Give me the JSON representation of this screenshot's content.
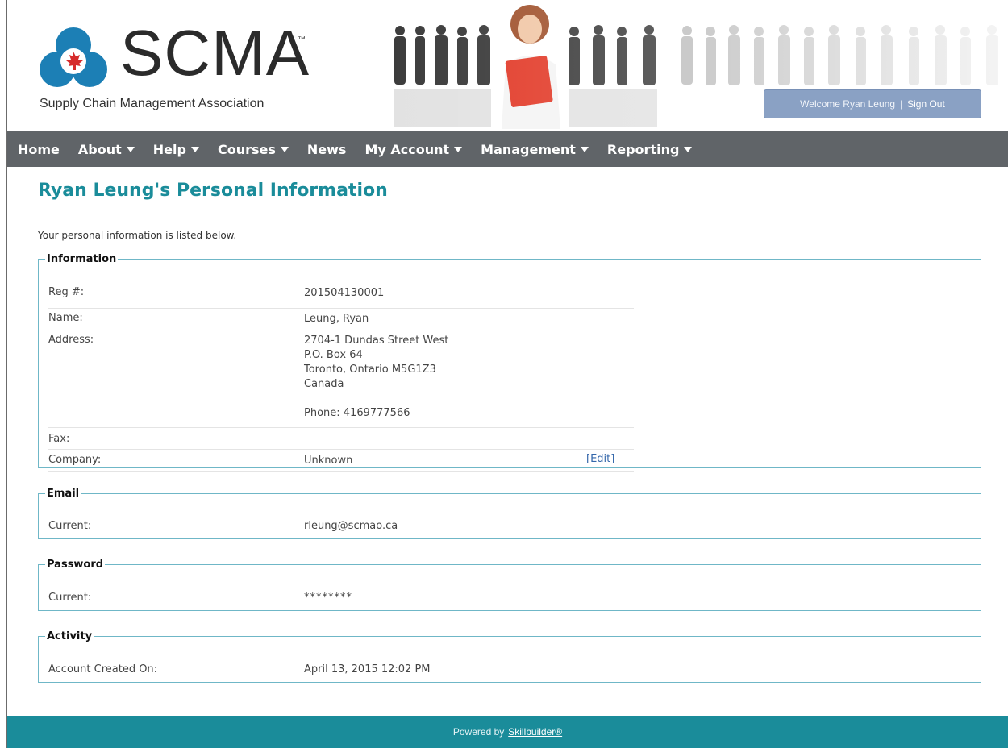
{
  "header": {
    "logo_text": "SCMA",
    "logo_tm": "™",
    "logo_subtitle": "Supply Chain Management Association",
    "welcome_text": "Welcome Ryan Leung",
    "separator": "|",
    "signout_label": "Sign Out"
  },
  "nav": {
    "items": [
      {
        "label": "Home",
        "caret": false
      },
      {
        "label": "About",
        "caret": true
      },
      {
        "label": "Help",
        "caret": true
      },
      {
        "label": "Courses",
        "caret": true
      },
      {
        "label": "News",
        "caret": false
      },
      {
        "label": "My Account",
        "caret": true
      },
      {
        "label": "Management",
        "caret": true
      },
      {
        "label": "Reporting",
        "caret": true
      }
    ]
  },
  "page": {
    "title": "Ryan Leung's Personal Information",
    "intro": "Your personal information is listed below."
  },
  "information": {
    "legend": "Information",
    "reg_label": "Reg #:",
    "reg_value": "201504130001",
    "name_label": "Name:",
    "name_value": "Leung, Ryan",
    "address_label": "Address:",
    "address_lines": [
      "2704-1 Dundas Street West",
      "P.O. Box 64",
      "Toronto, Ontario M5G1Z3",
      "Canada"
    ],
    "phone": "Phone: 4169777566",
    "fax_label": "Fax:",
    "fax_value": "",
    "company_label": "Company:",
    "company_value": "Unknown",
    "edit_label": "[Edit]"
  },
  "email": {
    "legend": "Email",
    "current_label": "Current:",
    "current_value": "rleung@scmao.ca"
  },
  "password": {
    "legend": "Password",
    "current_label": "Current:",
    "current_value": "********"
  },
  "activity": {
    "legend": "Activity",
    "created_label": "Account Created On:",
    "created_value": "April 13, 2015 12:02 PM"
  },
  "footer": {
    "powered_by": "Powered by",
    "link": "Skillbuilder®"
  },
  "colors": {
    "accent": "#1a8c9a",
    "nav_bg": "#606468",
    "welcome_bg": "#8aa1c4"
  }
}
